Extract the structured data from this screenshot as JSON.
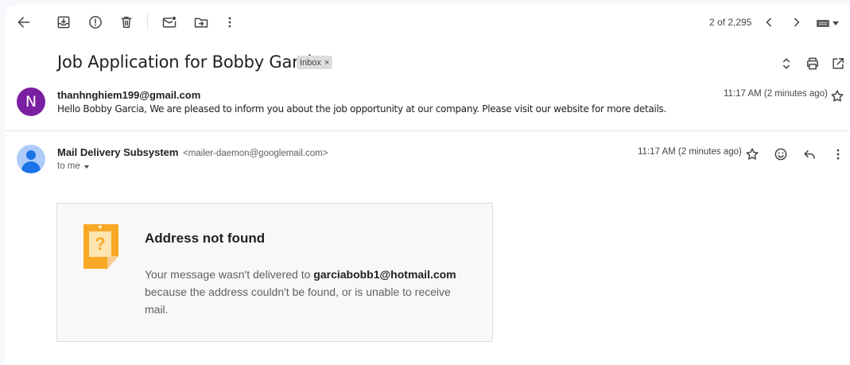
{
  "toolbar": {
    "icons": [
      "back-arrow-icon",
      "archive-icon",
      "report-spam-icon",
      "delete-icon",
      "mark-unread-icon",
      "move-to-icon",
      "more-vert-icon"
    ],
    "page_count": "2 of 2,295",
    "nav_icons": [
      "chevron-left-icon",
      "chevron-right-icon"
    ],
    "input_tools_icon": "keyboard-icon"
  },
  "thread": {
    "subject": "Job Application for Bobby Garcia",
    "label": "Inbox",
    "label_remove": "×",
    "actions": [
      "expand-collapse-icon",
      "print-icon",
      "open-new-window-icon"
    ]
  },
  "messages": [
    {
      "avatar_letter": "N",
      "avatar_color": "#7b1fa2",
      "sender": "thanhnghiem199@gmail.com",
      "snippet": "Hello Bobby Garcia, We are pleased to inform you about the job opportunity at our company. Please visit our website for more details.",
      "time": "11:17 AM (2 minutes ago)"
    },
    {
      "sender_name": "Mail Delivery Subsystem",
      "sender_email": "<mailer-daemon@googlemail.com>",
      "recipient": "to me",
      "time": "11:17 AM (2 minutes ago)",
      "actions": [
        "star-icon",
        "emoji-react-icon",
        "reply-icon",
        "more-vert-icon"
      ]
    }
  ],
  "bounce": {
    "title": "Address not found",
    "msg_before": "Your message wasn't delivered to ",
    "address": "garciabobb1@hotmail.com",
    "msg_after": " because the address couldn't be found, or is unable to receive mail.",
    "icon_color": "#f9a825"
  }
}
